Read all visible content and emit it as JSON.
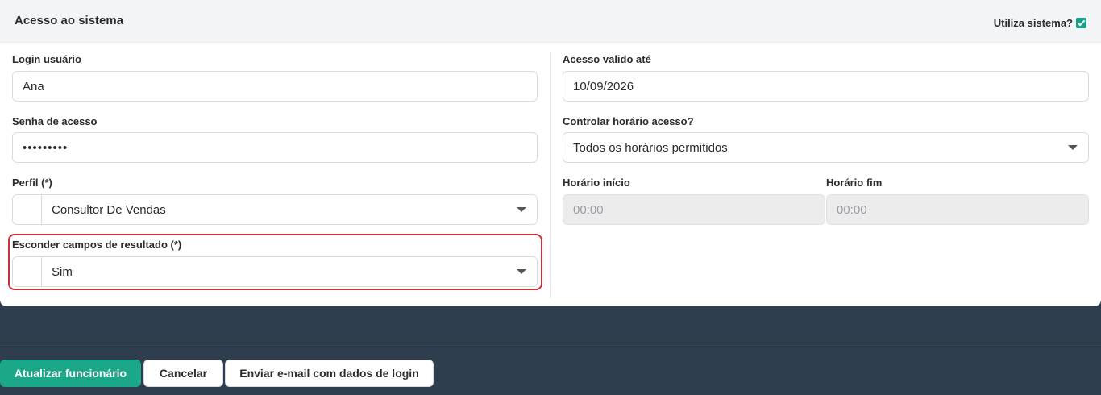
{
  "header": {
    "title": "Acesso ao sistema",
    "utiliza_label": "Utiliza sistema?",
    "utiliza_checked": true,
    "accent": "#16a085"
  },
  "left": {
    "login": {
      "label": "Login usuário",
      "value": "Ana"
    },
    "senha": {
      "label": "Senha de acesso",
      "value": "•••••••••"
    },
    "perfil": {
      "label": "Perfil (*)",
      "selected": "Consultor De Vendas"
    },
    "esconder": {
      "label": "Esconder campos de resultado (*)",
      "selected": "Sim",
      "highlight_color": "#c8303a"
    }
  },
  "right": {
    "acesso": {
      "label": "Acesso valido até",
      "value": "10/09/2026"
    },
    "controlar": {
      "label": "Controlar horário acesso?",
      "selected": "Todos os horários permitidos"
    },
    "inicio": {
      "label": "Horário início",
      "placeholder": "00:00"
    },
    "fim": {
      "label": "Horário fim",
      "placeholder": "00:00"
    }
  },
  "footer": {
    "update": "Atualizar funcionário",
    "cancel": "Cancelar",
    "email": "Enviar e-mail com dados de login"
  }
}
